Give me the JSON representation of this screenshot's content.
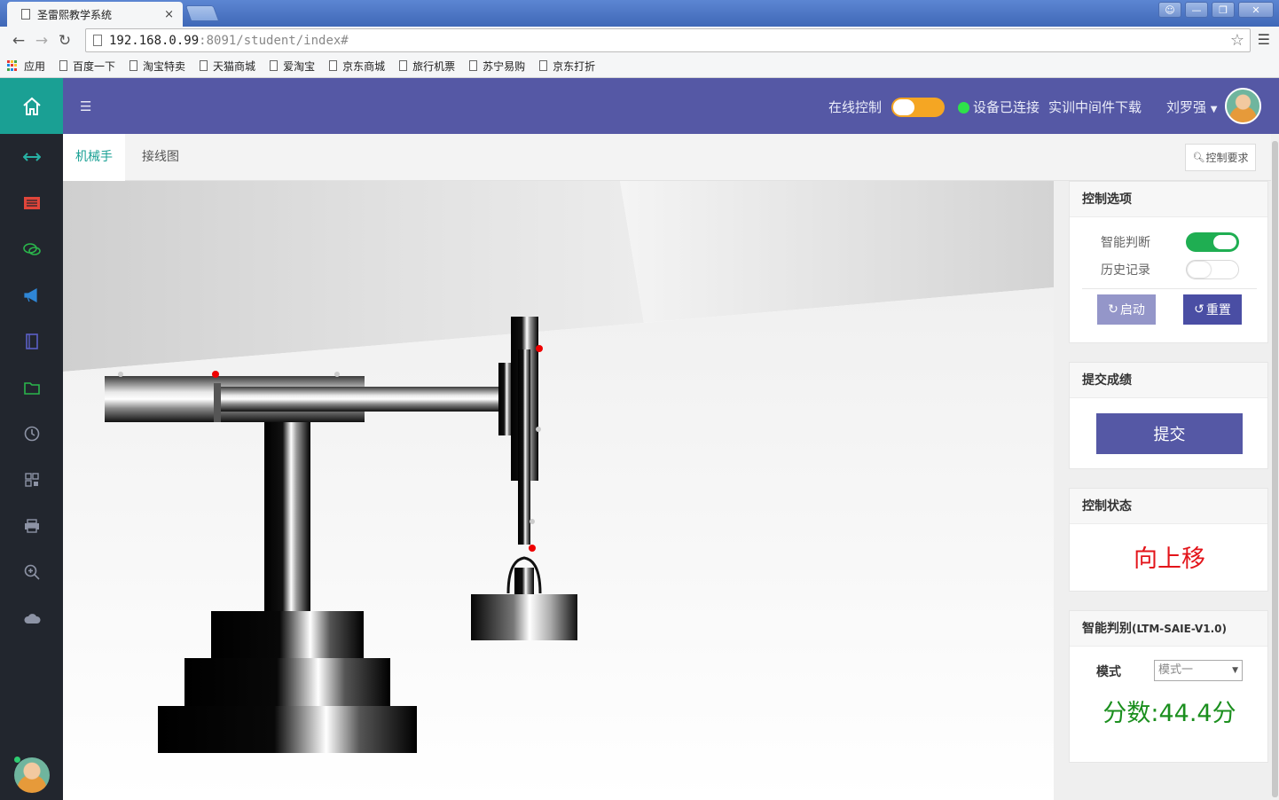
{
  "browser": {
    "tab_title": "圣雷熙教学系统",
    "tab_close": "×",
    "url_host": "192.168.0.99",
    "url_rest": ":8091/student/index#",
    "bookmarks": [
      "应用",
      "百度一下",
      "淘宝特卖",
      "天猫商城",
      "爱淘宝",
      "京东商城",
      "旅行机票",
      "苏宁易购",
      "京东打折"
    ]
  },
  "header": {
    "online_control_label": "在线控制",
    "device_status": "设备已连接",
    "download_label": "实训中间件下载",
    "user_name": "刘罗强"
  },
  "tabs": {
    "robot_arm": "机械手",
    "wiring": "接线图",
    "requirements_button": "控制要求"
  },
  "sidebar": {
    "icons": [
      "arrows-icon",
      "list-icon",
      "chat-icon",
      "bullhorn-icon",
      "book-icon",
      "folder-icon",
      "clock-icon",
      "qrcode-icon",
      "print-icon",
      "zoom-icon",
      "cloud-icon"
    ]
  },
  "control_options": {
    "title": "控制选项",
    "smart_judge_label": "智能判断",
    "smart_judge_on": true,
    "history_label": "历史记录",
    "history_on": false,
    "start_button": "启动",
    "reset_button": "重置"
  },
  "submit_card": {
    "title": "提交成绩",
    "submit_button": "提交"
  },
  "status_card": {
    "title": "控制状态",
    "status_text": "向上移"
  },
  "judge_card": {
    "title": "智能判别",
    "version": "(LTM-SAIE-V1.0)",
    "mode_label": "模式",
    "mode_value": "模式一",
    "score_text": "分数:44.4分"
  },
  "colors": {
    "header_bg": "#5558a5",
    "accent_teal": "#1aa094",
    "status_red": "#e3141a",
    "score_green": "#1b8f1e"
  }
}
